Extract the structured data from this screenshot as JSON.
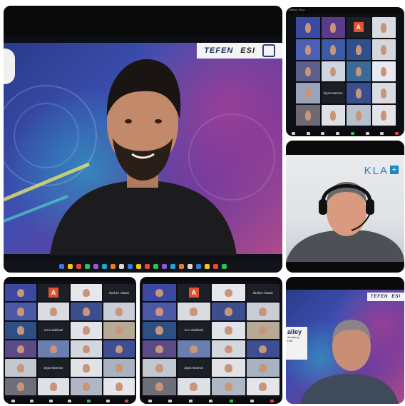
{
  "main_call": {
    "slide_logos": [
      "TEFEN",
      "ESI"
    ],
    "taskbar_icons": [
      "start",
      "search",
      "taskview",
      "chrome",
      "edge",
      "explorer",
      "mail",
      "teams",
      "acrobat",
      "powerpoint",
      "excel",
      "word",
      "zoom",
      "settings",
      "photos",
      "store",
      "calendar",
      "camera",
      "onenote",
      "outlook"
    ]
  },
  "gallery_top": {
    "header": "Gallery View",
    "tiles": [
      {
        "kind": "video",
        "bg": "#3b4aa0"
      },
      {
        "kind": "video",
        "bg": "#5a3b8a"
      },
      {
        "kind": "avatar",
        "letter": "A"
      },
      {
        "kind": "video",
        "bg": "#d8dbe0"
      },
      {
        "kind": "video",
        "bg": "#4a5fb5"
      },
      {
        "kind": "video",
        "bg": "#3d5aa5"
      },
      {
        "kind": "video",
        "bg": "#2f4f8f"
      },
      {
        "kind": "video",
        "bg": "#d5d7dc"
      },
      {
        "kind": "video",
        "bg": "#5b5f8e"
      },
      {
        "kind": "video",
        "bg": "#cdd6de"
      },
      {
        "kind": "video",
        "bg": "#3c6b9a"
      },
      {
        "kind": "video",
        "bg": "#e7e9ee"
      },
      {
        "kind": "video",
        "bg": "#9aa4b6"
      },
      {
        "kind": "name",
        "text": "Ziyan Marmon"
      },
      {
        "kind": "video",
        "bg": "#3a4d8e"
      },
      {
        "kind": "video",
        "bg": "#d9dce3"
      },
      {
        "kind": "video",
        "bg": "#6e6a73"
      },
      {
        "kind": "video",
        "bg": "#dde1e5"
      },
      {
        "kind": "video",
        "bg": "#b6c0cf"
      },
      {
        "kind": "video",
        "bg": "#e2e4e8"
      }
    ]
  },
  "kla_call": {
    "logo": "KLA"
  },
  "gallery_bl": {
    "tiles": [
      {
        "kind": "video",
        "bg": "#3b4aa0"
      },
      {
        "kind": "avatar",
        "letter": "A"
      },
      {
        "kind": "video",
        "bg": "#e5e7ea"
      },
      {
        "kind": "name",
        "text": "Ibrahim Akarak"
      },
      {
        "kind": "video",
        "bg": "#4c5aa6"
      },
      {
        "kind": "video",
        "bg": "#d9dbe0"
      },
      {
        "kind": "video",
        "bg": "#3c4f8c"
      },
      {
        "kind": "video",
        "bg": "#c9ced6"
      },
      {
        "kind": "video",
        "bg": "#2d4f86"
      },
      {
        "kind": "name",
        "text": "Koi Lokakhatti"
      },
      {
        "kind": "video",
        "bg": "#dfe3e8"
      },
      {
        "kind": "video",
        "bg": "#b8a994"
      },
      {
        "kind": "video",
        "bg": "#5a4a86"
      },
      {
        "kind": "video",
        "bg": "#6a7fb0"
      },
      {
        "kind": "video",
        "bg": "#d4d8de"
      },
      {
        "kind": "video",
        "bg": "#3d4e94"
      },
      {
        "kind": "video",
        "bg": "#c2c8d0"
      },
      {
        "kind": "name",
        "text": "Ziyan Marmon"
      },
      {
        "kind": "video",
        "bg": "#e0e2e6"
      },
      {
        "kind": "video",
        "bg": "#a8b2c0"
      },
      {
        "kind": "video",
        "bg": "#6e6f78"
      },
      {
        "kind": "video",
        "bg": "#dde0e4"
      },
      {
        "kind": "video",
        "bg": "#b0b8c6"
      },
      {
        "kind": "video",
        "bg": "#e4e6e9"
      }
    ]
  },
  "gallery_bm": {
    "tiles": [
      {
        "kind": "video",
        "bg": "#3b4aa0"
      },
      {
        "kind": "avatar",
        "letter": "A"
      },
      {
        "kind": "video",
        "bg": "#e5e7ea"
      },
      {
        "kind": "name",
        "text": "Ibrahim Akarak"
      },
      {
        "kind": "video",
        "bg": "#4c5aa6"
      },
      {
        "kind": "video",
        "bg": "#d9dbe0"
      },
      {
        "kind": "video",
        "bg": "#3c4f8c"
      },
      {
        "kind": "video",
        "bg": "#c9ced6"
      },
      {
        "kind": "video",
        "bg": "#2d4f86"
      },
      {
        "kind": "name",
        "text": "Koi Lokakhatti"
      },
      {
        "kind": "video",
        "bg": "#dfe3e8"
      },
      {
        "kind": "video",
        "bg": "#b8a994"
      },
      {
        "kind": "video",
        "bg": "#5a4a86"
      },
      {
        "kind": "video",
        "bg": "#6a7fb0"
      },
      {
        "kind": "video",
        "bg": "#d4d8de"
      },
      {
        "kind": "video",
        "bg": "#3d4e94"
      },
      {
        "kind": "video",
        "bg": "#c2c8d0"
      },
      {
        "kind": "name",
        "text": "Ziyan Marmon"
      },
      {
        "kind": "video",
        "bg": "#e0e2e6"
      },
      {
        "kind": "video",
        "bg": "#a8b2c0"
      },
      {
        "kind": "video",
        "bg": "#6e6f78"
      },
      {
        "kind": "video",
        "bg": "#dde0e4"
      },
      {
        "kind": "video",
        "bg": "#b0b8c6"
      },
      {
        "kind": "video",
        "bg": "#e4e6e9"
      }
    ]
  },
  "br_call": {
    "slide_logos": [
      "TEFEN",
      "ESI"
    ],
    "slide_text": [
      "alley",
      "Academy",
      "Hub"
    ]
  },
  "colors": {
    "panel_dark": "#0d0f16",
    "kla_blue": "#1e86c8",
    "zoom_green": "#2fbf57",
    "zoom_red": "#e04040"
  }
}
